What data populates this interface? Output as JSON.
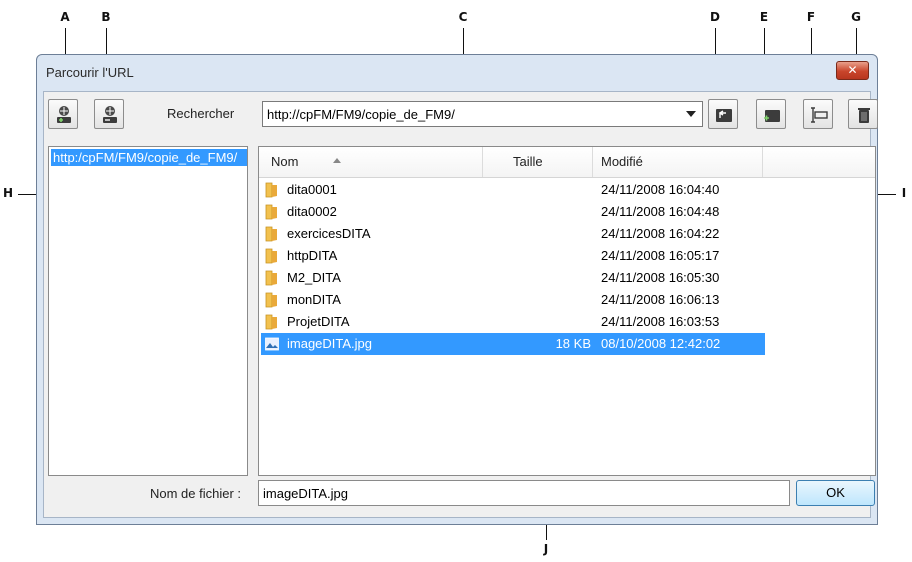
{
  "callouts": {
    "a": "A",
    "b": "B",
    "c": "C",
    "d": "D",
    "e": "E",
    "f": "F",
    "g": "G",
    "h": "H",
    "i": "I",
    "j": "J"
  },
  "dialog": {
    "title": "Parcourir l'URL",
    "close_glyph": "✕"
  },
  "toolbar": {
    "search_label": "Rechercher",
    "url_value": "http://cpFM/FM9/copie_de_FM9/",
    "icons": [
      "add-url-icon",
      "remove-url-icon",
      "parent-folder-icon",
      "new-folder-icon",
      "rename-icon",
      "delete-icon"
    ]
  },
  "tree": {
    "selected_item": "http:/cpFM/FM9/copie_de_FM9/"
  },
  "list": {
    "columns": {
      "name": "Nom",
      "size": "Taille",
      "modified": "Modifié"
    },
    "rows": [
      {
        "name": "dita0001",
        "size": "",
        "modified": "24/11/2008 16:04:40",
        "type": "folder"
      },
      {
        "name": "dita0002",
        "size": "",
        "modified": "24/11/2008 16:04:48",
        "type": "folder"
      },
      {
        "name": "exercicesDITA",
        "size": "",
        "modified": "24/11/2008 16:04:22",
        "type": "folder"
      },
      {
        "name": "httpDITA",
        "size": "",
        "modified": "24/11/2008 16:05:17",
        "type": "folder"
      },
      {
        "name": "M2_DITA",
        "size": "",
        "modified": "24/11/2008 16:05:30",
        "type": "folder"
      },
      {
        "name": "monDITA",
        "size": "",
        "modified": "24/11/2008 16:06:13",
        "type": "folder"
      },
      {
        "name": "ProjetDITA",
        "size": "",
        "modified": "24/11/2008 16:03:53",
        "type": "folder"
      },
      {
        "name": "imageDITA.jpg",
        "size": "18 KB",
        "modified": "08/10/2008 12:42:02",
        "type": "image",
        "selected": true
      }
    ]
  },
  "footer": {
    "filename_label": "Nom de fichier :",
    "filename_value": "imageDITA.jpg",
    "ok_label": "OK"
  },
  "colors": {
    "selection": "#3399ff",
    "folder": "#f2c14e",
    "close_button": "#c9452b"
  }
}
